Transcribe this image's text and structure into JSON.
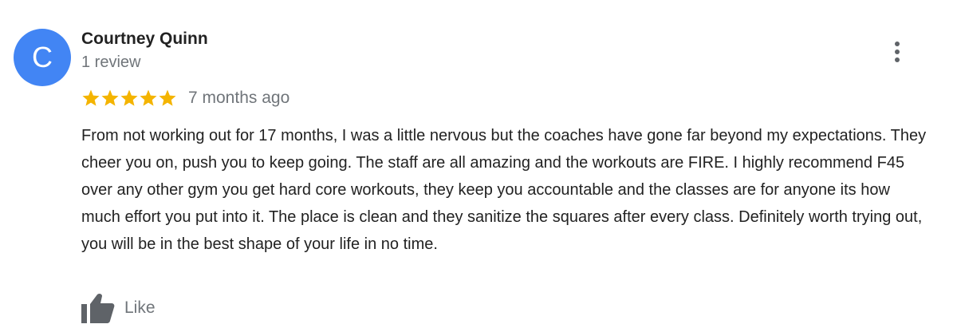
{
  "review": {
    "avatar_letter": "C",
    "avatar_color": "#4285f4",
    "reviewer_name": "Courtney Quinn",
    "review_count": "1 review",
    "rating": 5,
    "rating_max": 5,
    "star_color": "#f4b400",
    "date": "7 months ago",
    "text": "From not working out for 17 months, I was a little nervous but the coaches have gone far beyond my expectations. They cheer you on, push you to keep going. The staff are all amazing and the workouts are FIRE. I highly recommend F45 over any other gym you get hard core workouts, they keep you accountable and the classes are for anyone its how much effort you put into it. The place is clean and they sanitize the squares after every class. Definitely worth trying out, you will be in the best shape of your life in no time.",
    "like_label": "Like",
    "icons": {
      "more": "more-vert-icon",
      "star": "star-icon",
      "like": "thumbs-up-icon"
    }
  }
}
